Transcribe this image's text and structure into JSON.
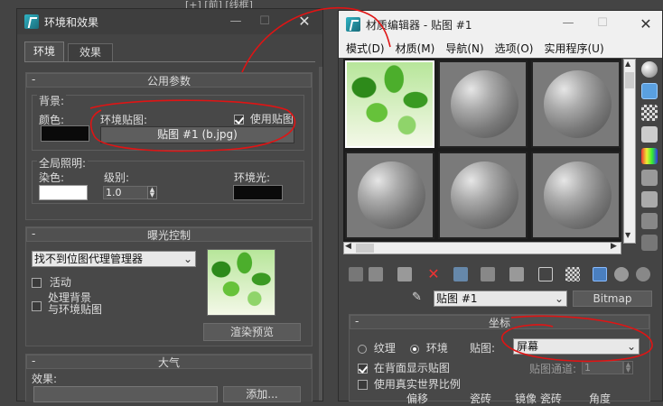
{
  "background_strip": {
    "text": "[+] [前] [线框]"
  },
  "env_window": {
    "title": "环境和效果",
    "tabs": [
      {
        "label": "环境"
      },
      {
        "label": "效果"
      }
    ],
    "common_params": {
      "header": "公用参数",
      "background_label": "背景:",
      "color_label": "颜色:",
      "env_map_label": "环境贴图:",
      "use_map_label": "使用贴图",
      "map_button": "贴图 #1 (b.jpg)",
      "global_lighting_label": "全局照明:",
      "tint_label": "染色:",
      "level_label": "级别:",
      "level_value": "1.0",
      "ambient_label": "环境光:"
    },
    "exposure": {
      "header": "曝光控制",
      "dropdown_value": "找不到位图代理管理器",
      "active_label": "活动",
      "process_bg_label": "处理背景\n与环境贴图",
      "render_preview_button": "渲染预览"
    },
    "atmosphere": {
      "header": "大气",
      "effects_label": "效果:",
      "add_button": "添加..."
    }
  },
  "mat_editor": {
    "title": "材质编辑器 - 贴图 #1",
    "menu": [
      "模式(D)",
      "材质(M)",
      "导航(N)",
      "选项(O)",
      "实用程序(U)"
    ],
    "map_name": "贴图 #1",
    "map_type": "Bitmap",
    "coords": {
      "header": "坐标",
      "texture_label": "纹理",
      "environ_label": "环境",
      "mapping_label": "贴图:",
      "mapping_value": "屏幕",
      "show_back_label": "在背面显示贴图",
      "map_channel_label": "贴图通道:",
      "map_channel_value": "1",
      "real_world_label": "使用真实世界比例",
      "col_headers": [
        "偏移",
        "瓷砖",
        "镜像 瓷砖",
        "角度"
      ]
    }
  }
}
